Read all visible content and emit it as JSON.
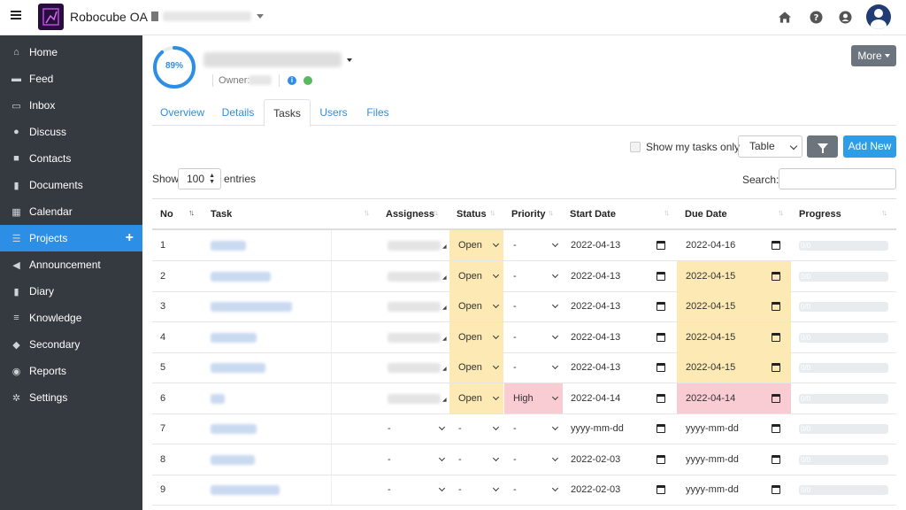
{
  "app": {
    "title": "Robocube OA"
  },
  "sidebar": {
    "items": [
      {
        "label": "Home",
        "icon": "home-icon",
        "glyph": "⌂"
      },
      {
        "label": "Feed",
        "icon": "comment-icon",
        "glyph": "▬"
      },
      {
        "label": "Inbox",
        "icon": "inbox-icon",
        "glyph": "▭"
      },
      {
        "label": "Discuss",
        "icon": "chat-icon",
        "glyph": "●"
      },
      {
        "label": "Contacts",
        "icon": "address-book-icon",
        "glyph": "■"
      },
      {
        "label": "Documents",
        "icon": "file-icon",
        "glyph": "▮"
      },
      {
        "label": "Calendar",
        "icon": "calendar-icon",
        "glyph": "▦"
      },
      {
        "label": "Projects",
        "icon": "list-icon",
        "glyph": "☰",
        "active": true
      },
      {
        "label": "Announcement",
        "icon": "bullhorn-icon",
        "glyph": "◀"
      },
      {
        "label": "Diary",
        "icon": "book-icon",
        "glyph": "▮"
      },
      {
        "label": "Knowledge",
        "icon": "database-icon",
        "glyph": "≡"
      },
      {
        "label": "Secondary",
        "icon": "tags-icon",
        "glyph": "◆"
      },
      {
        "label": "Reports",
        "icon": "chart-icon",
        "glyph": "◉"
      },
      {
        "label": "Settings",
        "icon": "cogs-icon",
        "glyph": "✲"
      }
    ],
    "add_glyph": "+"
  },
  "project": {
    "progress_percent": 89,
    "progress_label": "89%",
    "owner_label": "Owner:",
    "info_glyph": "i",
    "more_label": "More"
  },
  "tabs": [
    {
      "label": "Overview"
    },
    {
      "label": "Details"
    },
    {
      "label": "Tasks",
      "active": true
    },
    {
      "label": "Users"
    },
    {
      "label": "Files"
    }
  ],
  "toolbar": {
    "show_my_tasks_label": "Show my tasks only",
    "view_select_value": "Table",
    "add_new_label": "Add New"
  },
  "entries": {
    "show_label": "Show",
    "value": "100",
    "entries_label": "entries",
    "search_label": "Search:"
  },
  "table": {
    "headers": [
      "No",
      "Task",
      "Assigness",
      "Status",
      "Priority",
      "Start Date",
      "Due Date",
      "Progress"
    ],
    "rows": [
      {
        "no": "1",
        "assignee": "",
        "status": "Open",
        "priority": "-",
        "start": "2022-04-13",
        "due": "2022-04-16",
        "progress_label": "0/0",
        "due_bg": "",
        "pri_bg": ""
      },
      {
        "no": "2",
        "assignee": "",
        "status": "Open",
        "priority": "-",
        "start": "2022-04-13",
        "due": "2022-04-15",
        "progress_label": "0/0",
        "due_bg": "yellow",
        "pri_bg": ""
      },
      {
        "no": "3",
        "assignee": "",
        "status": "Open",
        "priority": "-",
        "start": "2022-04-13",
        "due": "2022-04-15",
        "progress_label": "0/0",
        "due_bg": "yellow",
        "pri_bg": ""
      },
      {
        "no": "4",
        "assignee": "",
        "status": "Open",
        "priority": "-",
        "start": "2022-04-13",
        "due": "2022-04-15",
        "progress_label": "0/0",
        "due_bg": "yellow",
        "pri_bg": ""
      },
      {
        "no": "5",
        "assignee": "",
        "status": "Open",
        "priority": "-",
        "start": "2022-04-13",
        "due": "2022-04-15",
        "progress_label": "0/0",
        "due_bg": "yellow",
        "pri_bg": ""
      },
      {
        "no": "6",
        "assignee": "",
        "status": "Open",
        "priority": "High",
        "start": "2022-04-14",
        "due": "2022-04-14",
        "progress_label": "0/0",
        "due_bg": "pink",
        "pri_bg": "pink"
      },
      {
        "no": "7",
        "assignee": "-",
        "status": "-",
        "priority": "-",
        "start": "yyyy-mm-dd",
        "due": "yyyy-mm-dd",
        "progress_label": "0/0",
        "due_bg": "",
        "pri_bg": ""
      },
      {
        "no": "8",
        "assignee": "-",
        "status": "-",
        "priority": "-",
        "start": "2022-02-03",
        "due": "yyyy-mm-dd",
        "progress_label": "0/0",
        "due_bg": "",
        "pri_bg": ""
      },
      {
        "no": "9",
        "assignee": "-",
        "status": "-",
        "priority": "-",
        "start": "2022-02-03",
        "due": "yyyy-mm-dd",
        "progress_label": "0/0",
        "due_bg": "",
        "pri_bg": ""
      }
    ]
  },
  "colors": {
    "accent": "#2d8ee6",
    "sidebar": "#343a40",
    "warning_bg": "#fde9b3",
    "danger_bg": "#f9cbd3"
  }
}
